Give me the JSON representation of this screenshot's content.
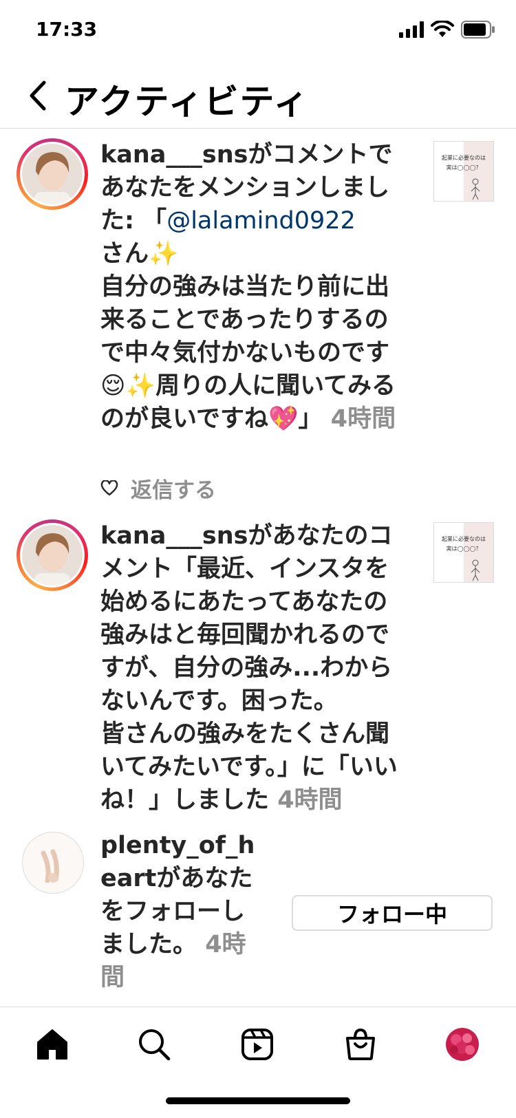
{
  "status": {
    "time": "17:33"
  },
  "header": {
    "title": "アクティビティ"
  },
  "items": [
    {
      "username": "kana___sns",
      "text_before": "がコメントであなたをメンションしました: 「",
      "mention": "@lalamind0922",
      "text_after": "さん✨\n自分の強みは当たり前に出来ることであったりするので中々気付かないものです😌✨周りの人に聞いてみるのが良いですね💖」",
      "time": "4時間",
      "reply_label": "返信する",
      "thumb_title": "起業に必要なのは",
      "thumb_sub": "実は◯◯◯？"
    },
    {
      "username": "kana___sns",
      "text": "があなたのコメント「最近、インスタを始めるにあたってあなたの強みはと毎回聞かれるのですが、自分の強み...わからないんです。困った。\n皆さんの強みをたくさん聞いてみたいです。」に「いいね！」しました",
      "time": "4時間",
      "thumb_title": "起業に必要なのは",
      "thumb_sub": "実は◯◯◯？"
    },
    {
      "username": "plenty_of_heart",
      "text": "があなたをフォローしました。",
      "time": "4時間",
      "button_label": "フォロー中"
    }
  ],
  "tabs": [
    "home",
    "search",
    "reels",
    "shop",
    "profile"
  ],
  "colors": {
    "mention": "#00376b",
    "timestamp": "#8e8e8e",
    "divider": "#dbdbdb"
  }
}
